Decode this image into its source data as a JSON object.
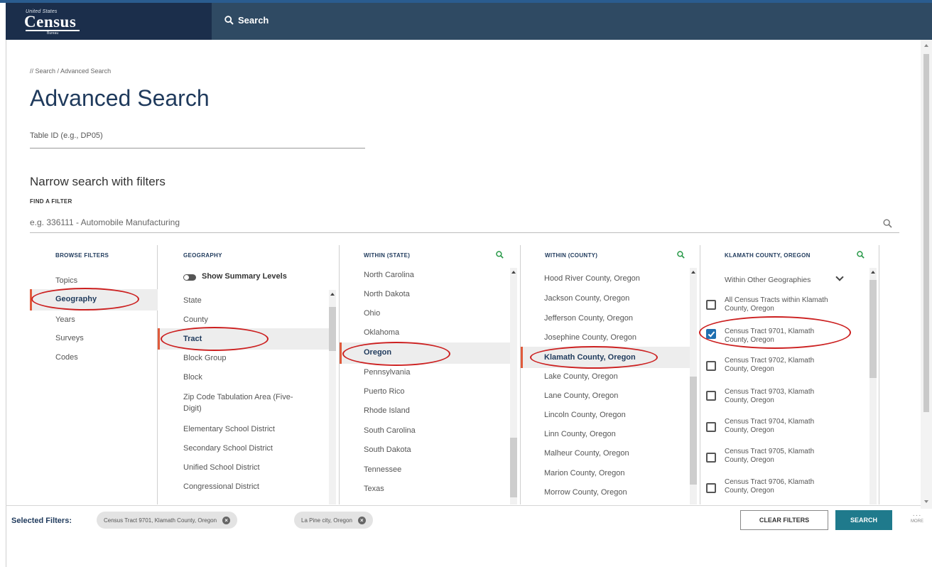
{
  "header": {
    "logo_small": "United States",
    "logo_main": "Census",
    "logo_bureau": "Bureau",
    "search_label": "Search"
  },
  "breadcrumb": "// Search / Advanced Search",
  "page_title": "Advanced Search",
  "table_id": {
    "placeholder": "Table ID (e.g., DP05)"
  },
  "narrow_heading": "Narrow search with filters",
  "find_filter": {
    "label": "FIND A FILTER",
    "placeholder": "e.g. 336111 - Automobile Manufacturing"
  },
  "browse_filters": {
    "header": "BROWSE FILTERS",
    "items": [
      "Topics",
      "Geography",
      "Years",
      "Surveys",
      "Codes"
    ],
    "selected": "Geography"
  },
  "geography": {
    "header": "GEOGRAPHY",
    "toggle_label": "Show Summary Levels",
    "items": [
      "State",
      "County",
      "Tract",
      "Block Group",
      "Block",
      "Zip Code Tabulation Area (Five-",
      "Digit)",
      "Elementary School District",
      "Secondary School District",
      "Unified School District",
      "Congressional District"
    ],
    "selected": "Tract"
  },
  "within_state": {
    "header": "WITHIN (STATE)",
    "items": [
      "North Carolina",
      "North Dakota",
      "Ohio",
      "Oklahoma",
      "Oregon",
      "Pennsylvania",
      "Puerto Rico",
      "Rhode Island",
      "South Carolina",
      "South Dakota",
      "Tennessee",
      "Texas"
    ],
    "selected": "Oregon"
  },
  "within_county": {
    "header": "WITHIN (COUNTY)",
    "items": [
      "Hood River County, Oregon",
      "Jackson County, Oregon",
      "Jefferson County, Oregon",
      "Josephine County, Oregon",
      "Klamath County, Oregon",
      "Lake County, Oregon",
      "Lane County, Oregon",
      "Lincoln County, Oregon",
      "Linn County, Oregon",
      "Malheur County, Oregon",
      "Marion County, Oregon",
      "Morrow County, Oregon"
    ],
    "selected": "Klamath County, Oregon"
  },
  "klamath": {
    "header": "KLAMATH COUNTY, OREGON",
    "within_other": "Within Other Geographies",
    "tracts": [
      {
        "line1": "All Census Tracts within Klamath",
        "line2": "County, Oregon",
        "checked": false
      },
      {
        "line1": "Census Tract 9701, Klamath",
        "line2": "County, Oregon",
        "checked": true
      },
      {
        "line1": "Census Tract 9702, Klamath",
        "line2": "County, Oregon",
        "checked": false
      },
      {
        "line1": "Census Tract 9703, Klamath",
        "line2": "County, Oregon",
        "checked": false
      },
      {
        "line1": "Census Tract 9704, Klamath",
        "line2": "County, Oregon",
        "checked": false
      },
      {
        "line1": "Census Tract 9705, Klamath",
        "line2": "County, Oregon",
        "checked": false
      },
      {
        "line1": "Census Tract 9706, Klamath",
        "line2": "County, Oregon",
        "checked": false
      }
    ]
  },
  "footer": {
    "label": "Selected Filters:",
    "chips": [
      "Census Tract 9701, Klamath County, Oregon",
      "La Pine city, Oregon"
    ],
    "clear_label": "CLEAR FILTERS",
    "search_label": "SEARCH",
    "more_label": "MORE"
  },
  "colors": {
    "header_bg": "#2f4a63",
    "logo_bg": "#1b2e4b",
    "title": "#1f3a5c",
    "accent_bar": "#e05a3b",
    "annotation_oval": "#cc2020",
    "search_button": "#1f7a8c",
    "checkbox_checked": "#1f6fb0",
    "search_icon": "#2a9a4a"
  }
}
